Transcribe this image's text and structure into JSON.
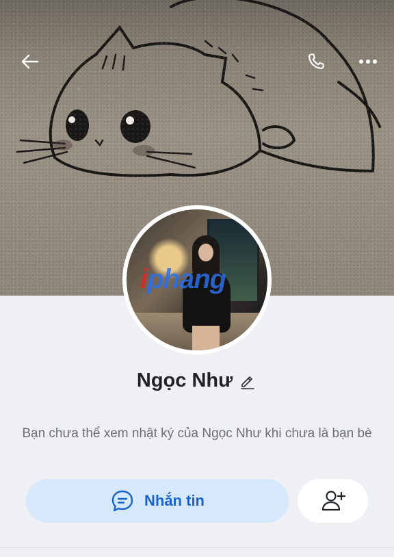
{
  "profile": {
    "name": "Ngọc Như",
    "notice": "Bạn chưa thể xem nhật ký của Ngọc Như khi chưa là bạn bè",
    "watermark": "phang"
  },
  "header": {
    "back_icon": "arrow-left-icon",
    "call_icon": "phone-icon",
    "more_icon": "more-horizontal-icon"
  },
  "actions": {
    "message_label": "Nhắn tin",
    "message_icon": "chat-bubble-icon",
    "add_friend_icon": "add-user-icon"
  },
  "colors": {
    "accent": "#1a63c9",
    "message_button_bg": "#d6e8fb",
    "page_bg": "#eef0f3"
  }
}
